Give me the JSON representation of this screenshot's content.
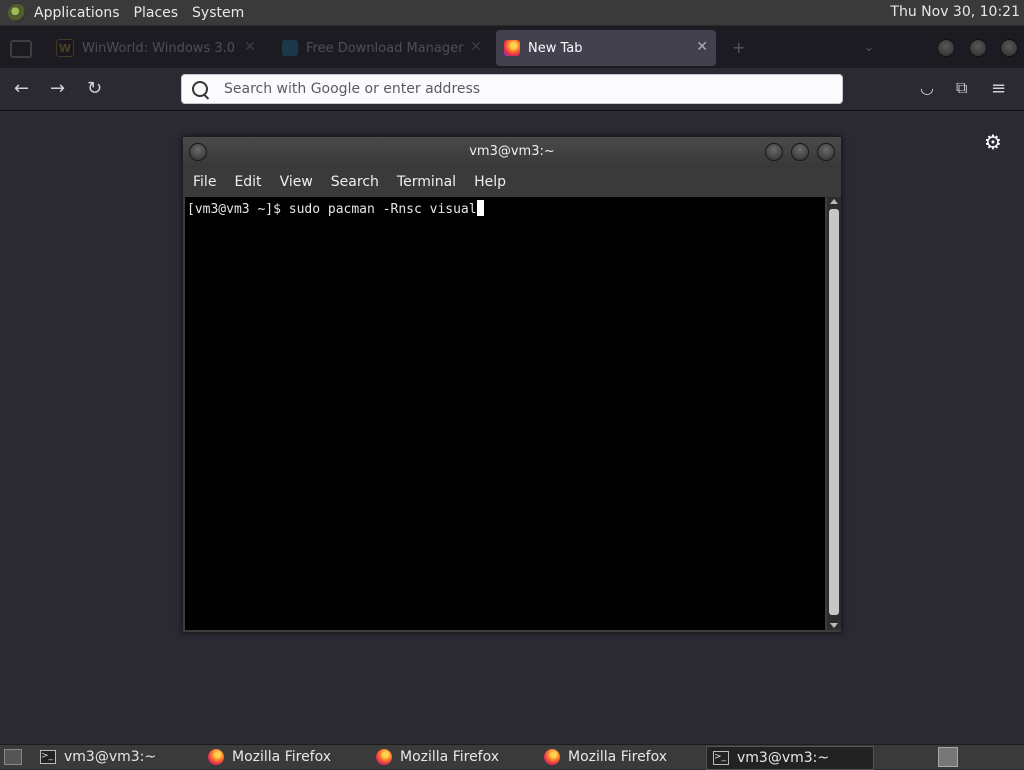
{
  "top_panel": {
    "menus": [
      "Applications",
      "Places",
      "System"
    ],
    "clock": "Thu Nov 30, 10:21"
  },
  "browser": {
    "tabs": [
      {
        "label": "WinWorld: Windows 3.0",
        "favicon": "winworld-icon",
        "state": "background"
      },
      {
        "label": "Free Download Manager",
        "favicon": "fdm-icon",
        "state": "background"
      },
      {
        "label": "New Tab",
        "favicon": "firefox-icon",
        "state": "active"
      }
    ],
    "urlbar": {
      "placeholder": "Search with Google or enter address",
      "value": ""
    }
  },
  "terminal": {
    "title": "vm3@vm3:~",
    "menu": [
      "File",
      "Edit",
      "View",
      "Search",
      "Terminal",
      "Help"
    ],
    "prompt_line": "[vm3@vm3 ~]$ sudo pacman -Rnsc visual"
  },
  "taskbar": {
    "items": [
      {
        "label": "vm3@vm3:~",
        "icon": "terminal-icon"
      },
      {
        "label": "Mozilla Firefox",
        "icon": "firefox-icon"
      },
      {
        "label": "Mozilla Firefox",
        "icon": "firefox-icon"
      },
      {
        "label": "Mozilla Firefox",
        "icon": "firefox-icon"
      },
      {
        "label": "vm3@vm3:~",
        "icon": "terminal-icon",
        "active": true
      }
    ]
  },
  "colors": {
    "page_bg": "#2b2a33",
    "tabstrip_bg": "#1c1b22",
    "terminal_bg": "#000000",
    "panel_bg": "#3a3a3a"
  }
}
